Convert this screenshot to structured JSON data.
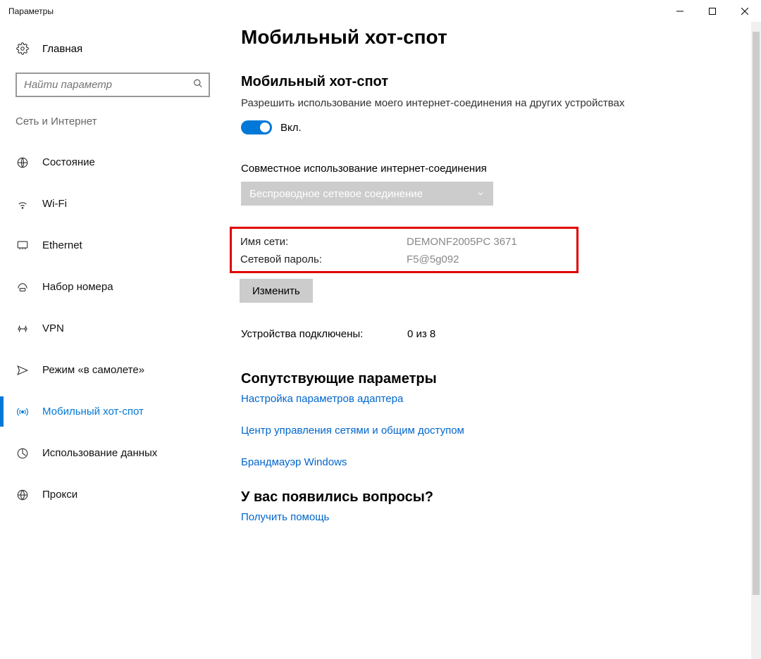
{
  "window": {
    "title": "Параметры"
  },
  "sidebar": {
    "home": "Главная",
    "search_placeholder": "Найти параметр",
    "category": "Сеть и Интернет",
    "items": [
      {
        "label": "Состояние"
      },
      {
        "label": "Wi-Fi"
      },
      {
        "label": "Ethernet"
      },
      {
        "label": "Набор номера"
      },
      {
        "label": "VPN"
      },
      {
        "label": "Режим «в самолете»"
      },
      {
        "label": "Мобильный хот-спот"
      },
      {
        "label": "Использование данных"
      },
      {
        "label": "Прокси"
      }
    ]
  },
  "main": {
    "title": "Мобильный хот-спот",
    "hotspot": {
      "heading": "Мобильный хот-спот",
      "desc": "Разрешить использование моего интернет-соединения на других устройствах",
      "toggle_label": "Вкл."
    },
    "share": {
      "label": "Совместное использование интернет-соединения",
      "combo_value": "Беспроводное сетевое соединение"
    },
    "network": {
      "name_label": "Имя сети:",
      "name_value": "DEMONF2005PC 3671",
      "pass_label": "Сетевой пароль:",
      "pass_value": "F5@5g092",
      "edit_btn": "Изменить"
    },
    "devices": {
      "label": "Устройства подключены:",
      "value": "0 из 8"
    },
    "related": {
      "heading": "Сопутствующие параметры",
      "links": [
        "Настройка параметров адаптера",
        "Центр управления сетями и общим доступом",
        "Брандмауэр Windows"
      ]
    },
    "questions": {
      "heading": "У вас появились вопросы?",
      "link": "Получить помощь"
    }
  }
}
